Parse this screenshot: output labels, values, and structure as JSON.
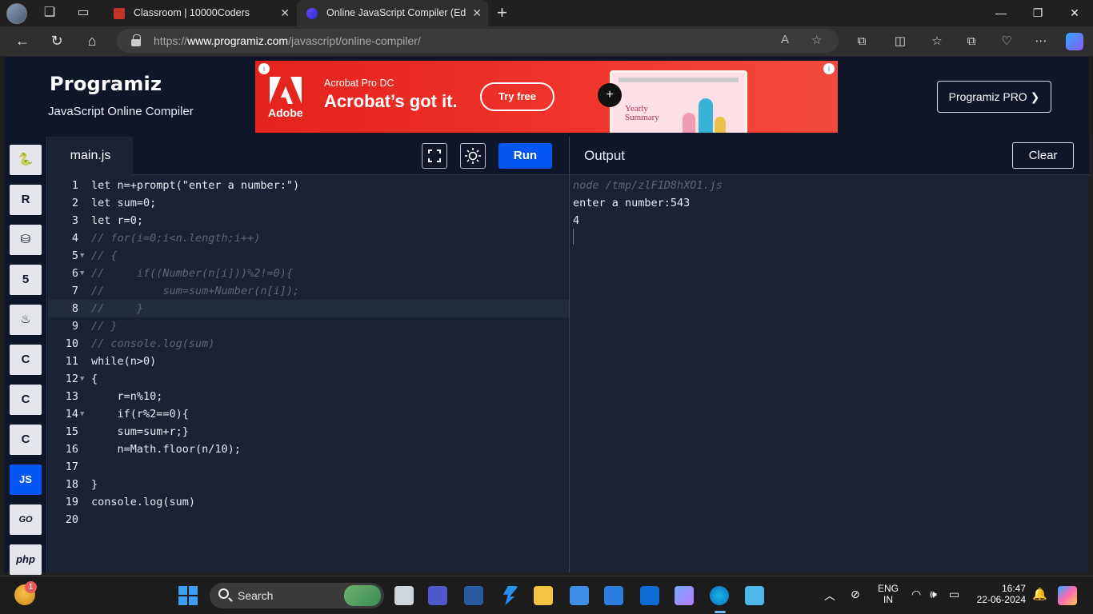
{
  "browser": {
    "tabs": [
      {
        "title": "Classroom | 10000Coders",
        "close": "✕"
      },
      {
        "title": "Online JavaScript Compiler (Edito",
        "close": "✕"
      }
    ],
    "new_tab": "+",
    "window": {
      "minimize": "—",
      "maximize": "❐",
      "close": "✕"
    },
    "url_prefix": "https://",
    "url_host": "www.programiz.com",
    "url_path": "/javascript/online-compiler/"
  },
  "site": {
    "logo": "Programiz",
    "subtitle": "JavaScript Online Compiler",
    "pro_button": "Programiz PRO ❯"
  },
  "ad": {
    "brand": "Adobe",
    "product": "Acrobat Pro DC",
    "tagline": "Acrobat’s got it.",
    "cta": "Try free",
    "doc_title": "Yearly\nSummary"
  },
  "rail": {
    "languages": [
      {
        "name": "python",
        "glyph": "🐍"
      },
      {
        "name": "r",
        "glyph": "R"
      },
      {
        "name": "sql",
        "glyph": "⛁"
      },
      {
        "name": "html",
        "glyph": "5"
      },
      {
        "name": "java",
        "glyph": "♨"
      },
      {
        "name": "c",
        "glyph": "C"
      },
      {
        "name": "cpp",
        "glyph": "C"
      },
      {
        "name": "csharp",
        "glyph": "C"
      },
      {
        "name": "js",
        "glyph": "JS"
      },
      {
        "name": "go",
        "glyph": "GO"
      },
      {
        "name": "php",
        "glyph": "php"
      }
    ]
  },
  "editor": {
    "file_tab": "main.js",
    "run_label": "Run",
    "lines": [
      {
        "n": "1",
        "fold": "",
        "code": "let n=+prompt(\"enter a number:\")",
        "comment": false
      },
      {
        "n": "2",
        "fold": "",
        "code": "let sum=0;",
        "comment": false
      },
      {
        "n": "3",
        "fold": "",
        "code": "let r=0;",
        "comment": false
      },
      {
        "n": "4",
        "fold": "",
        "code": "// for(i=0;i<n.length;i++)",
        "comment": true
      },
      {
        "n": "5",
        "fold": "▼",
        "code": "// {",
        "comment": true
      },
      {
        "n": "6",
        "fold": "▼",
        "code": "//     if((Number(n[i]))%2!=0){",
        "comment": true
      },
      {
        "n": "7",
        "fold": "",
        "code": "//         sum=sum+Number(n[i]);",
        "comment": true
      },
      {
        "n": "8",
        "fold": "",
        "code": "//     }",
        "comment": true
      },
      {
        "n": "9",
        "fold": "",
        "code": "// }",
        "comment": true
      },
      {
        "n": "10",
        "fold": "",
        "code": "// console.log(sum)",
        "comment": true
      },
      {
        "n": "11",
        "fold": "",
        "code": "while(n>0)",
        "comment": false
      },
      {
        "n": "12",
        "fold": "▼",
        "code": "{",
        "comment": false
      },
      {
        "n": "13",
        "fold": "",
        "code": "    r=n%10;",
        "comment": false
      },
      {
        "n": "14",
        "fold": "▼",
        "code": "    if(r%2==0){",
        "comment": false
      },
      {
        "n": "15",
        "fold": "",
        "code": "    sum=sum+r;}",
        "comment": false
      },
      {
        "n": "16",
        "fold": "",
        "code": "    n=Math.floor(n/10);",
        "comment": false
      },
      {
        "n": "17",
        "fold": "",
        "code": "",
        "comment": false
      },
      {
        "n": "18",
        "fold": "",
        "code": "}",
        "comment": false
      },
      {
        "n": "19",
        "fold": "",
        "code": "console.log(sum)",
        "comment": false
      },
      {
        "n": "20",
        "fold": "",
        "code": "",
        "comment": false
      }
    ],
    "current_line": 8
  },
  "output": {
    "title": "Output",
    "clear_label": "Clear",
    "lines": [
      {
        "text": "node /tmp/zlF1D8hXO1.js",
        "dim": true
      },
      {
        "text": "enter a number:543",
        "dim": false
      },
      {
        "text": "4",
        "dim": false
      }
    ]
  },
  "taskbar": {
    "search_label": "Search",
    "weather_badge": "1",
    "lang_top": "ENG",
    "lang_bottom": "IN",
    "time": "16:47",
    "date": "22-06-2024"
  }
}
